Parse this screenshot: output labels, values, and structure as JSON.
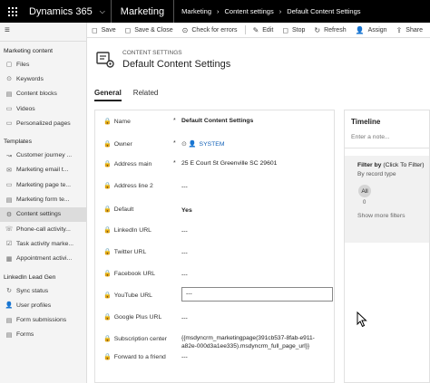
{
  "topbar": {
    "app_title": "Dynamics 365",
    "chevron": "⌵",
    "module": "Marketing",
    "breadcrumb": [
      "Marketing",
      "Content settings",
      "Default Content Settings"
    ],
    "breadcrumb_sep": "›"
  },
  "commands": [
    {
      "icon": "◻",
      "label": "Save"
    },
    {
      "icon": "◻",
      "label": "Save & Close"
    },
    {
      "icon": "⊙",
      "label": "Check for errors"
    },
    {
      "icon": "✎",
      "label": "Edit"
    },
    {
      "icon": "◻",
      "label": "Stop"
    },
    {
      "icon": "↻",
      "label": "Refresh"
    },
    {
      "icon": "👤",
      "label": "Assign"
    },
    {
      "icon": "⇪",
      "label": "Share"
    }
  ],
  "sidebar": {
    "hamburger": "≡",
    "group_marketing_content": "Marketing content",
    "marketing_content_items": [
      {
        "icon": "▢",
        "label": "Files"
      },
      {
        "icon": "⊙",
        "label": "Keywords"
      },
      {
        "icon": "▤",
        "label": "Content blocks"
      },
      {
        "icon": "▭",
        "label": "Videos"
      },
      {
        "icon": "▭",
        "label": "Personalized pages"
      }
    ],
    "group_templates": "Templates",
    "template_items": [
      {
        "icon": "↝",
        "label": "Customer journey ..."
      },
      {
        "icon": "✉",
        "label": "Marketing email t..."
      },
      {
        "icon": "▭",
        "label": "Marketing page te..."
      },
      {
        "icon": "▤",
        "label": "Marketing form te..."
      },
      {
        "icon": "⚙",
        "label": "Content settings"
      },
      {
        "icon": "☏",
        "label": "Phone-call activity..."
      },
      {
        "icon": "☑",
        "label": "Task activity marke..."
      },
      {
        "icon": "▦",
        "label": "Appointment activi..."
      }
    ],
    "group_linkedin": "LinkedIn Lead Gen",
    "linkedin_items": [
      {
        "icon": "↻",
        "label": "Sync status"
      },
      {
        "icon": "👤",
        "label": "User profiles"
      },
      {
        "icon": "▤",
        "label": "Form submissions"
      },
      {
        "icon": "▤",
        "label": "Forms"
      }
    ]
  },
  "header": {
    "entity_type": "CONTENT SETTINGS",
    "entity_name": "Default Content Settings"
  },
  "tabs": [
    "General",
    "Related"
  ],
  "form": {
    "name_label": "Name",
    "name_value": "Default Content Settings",
    "owner_label": "Owner",
    "owner_value": "SYSTEM",
    "address_main_label": "Address main",
    "address_main_value": "25 E Court St Greenville SC 29601",
    "address_line2_label": "Address line 2",
    "address_line2_value": "---",
    "default_label": "Default",
    "default_value": "Yes",
    "linkedin_label": "LinkedIn URL",
    "linkedin_value": "---",
    "twitter_label": "Twitter URL",
    "twitter_value": "---",
    "facebook_label": "Facebook URL",
    "facebook_value": "---",
    "youtube_label": "YouTube URL",
    "youtube_value": "---",
    "googleplus_label": "Google Plus URL",
    "googleplus_value": "---",
    "subscription_label": "Subscription center",
    "subscription_line1": "{{msdyncrm_marketingpage(391cb537-8fab-e911-",
    "subscription_line2": "a82e-000d3a1ee335).msdyncrm_full_page_url}}",
    "forward_label": "Forward to a friend",
    "forward_value": "---",
    "required_mark": "*",
    "lock_icon": "🔒"
  },
  "timeline": {
    "title": "Timeline",
    "note_placeholder": "Enter a note...",
    "filter_by": "Filter by",
    "filter_hint": "(Click To Filter)",
    "by_record_type": "By record type",
    "all_chip": "All",
    "all_count": "0",
    "show_more": "Show more filters"
  },
  "colors": {
    "topbar_bg": "#000000",
    "link": "#1160b7",
    "sidebar_bg": "#f4f4f4",
    "active_item": "#dcdcdc"
  }
}
